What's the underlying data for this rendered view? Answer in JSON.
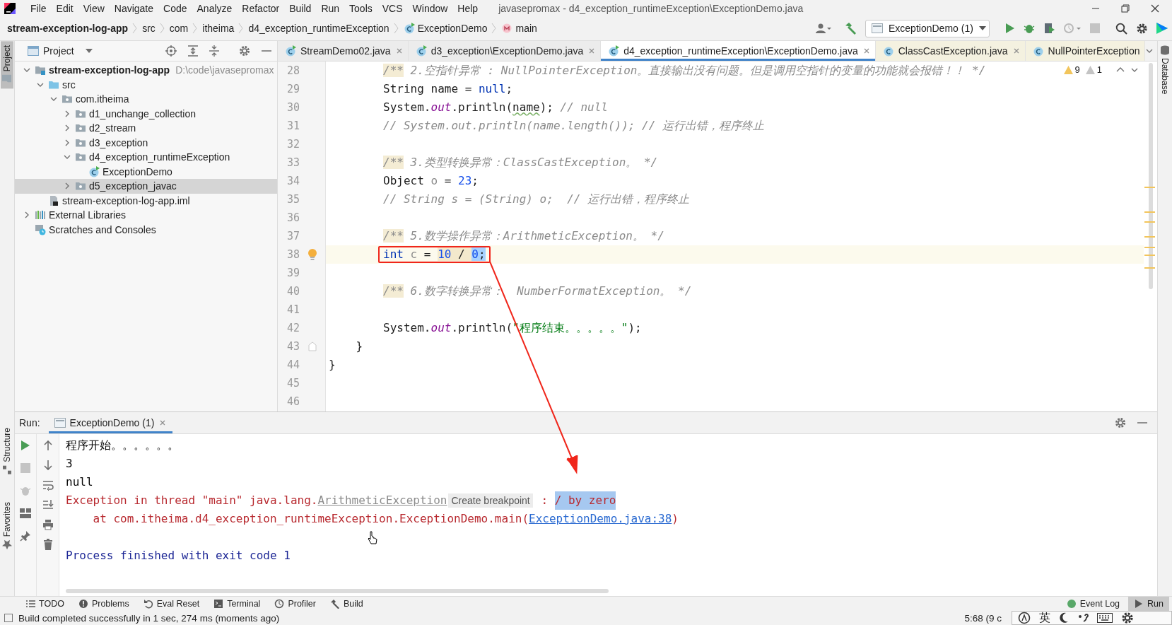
{
  "window": {
    "title": "javasepromax - d4_exception_runtimeException\\ExceptionDemo.java"
  },
  "menu": [
    "File",
    "Edit",
    "View",
    "Navigate",
    "Code",
    "Analyze",
    "Refactor",
    "Build",
    "Run",
    "Tools",
    "VCS",
    "Window",
    "Help"
  ],
  "breadcrumbs": [
    {
      "label": "stream-exception-log-app",
      "kind": "module"
    },
    {
      "label": "src",
      "kind": "plain"
    },
    {
      "label": "com",
      "kind": "plain"
    },
    {
      "label": "itheima",
      "kind": "plain"
    },
    {
      "label": "d4_exception_runtimeException",
      "kind": "plain"
    },
    {
      "label": "ExceptionDemo",
      "kind": "class"
    },
    {
      "label": "main",
      "kind": "method"
    }
  ],
  "run_config": {
    "label": "ExceptionDemo (1)"
  },
  "side_tabs": {
    "left": [
      {
        "label": "Project",
        "selected": true
      },
      {
        "label": "Structure",
        "selected": false
      },
      {
        "label": "Favorites",
        "selected": false
      }
    ],
    "right": [
      {
        "label": "Database",
        "selected": false
      }
    ]
  },
  "project": {
    "title": "Project",
    "tree": [
      {
        "label": "stream-exception-log-app",
        "kind": "module",
        "hint": "D:\\code\\javasepromax",
        "expanded": true,
        "selected": false,
        "children": [
          {
            "label": "src",
            "kind": "source",
            "expanded": true,
            "selected": false,
            "children": [
              {
                "label": "com.itheima",
                "kind": "package",
                "expanded": true,
                "selected": false,
                "children": [
                  {
                    "label": "d1_unchange_collection",
                    "kind": "package",
                    "expanded": false,
                    "selected": false
                  },
                  {
                    "label": "d2_stream",
                    "kind": "package",
                    "expanded": false,
                    "selected": false
                  },
                  {
                    "label": "d3_exception",
                    "kind": "package",
                    "expanded": false,
                    "selected": false
                  },
                  {
                    "label": "d4_exception_runtimeException",
                    "kind": "package",
                    "expanded": true,
                    "selected": false,
                    "children": [
                      {
                        "label": "ExceptionDemo",
                        "kind": "class",
                        "selected": false
                      }
                    ]
                  },
                  {
                    "label": "d5_exception_javac",
                    "kind": "package",
                    "expanded": false,
                    "selected": true
                  }
                ]
              }
            ]
          },
          {
            "label": "stream-exception-log-app.iml",
            "kind": "file",
            "selected": false
          }
        ]
      },
      {
        "label": "External Libraries",
        "kind": "libraries",
        "expanded": false,
        "selected": false
      },
      {
        "label": "Scratches and Consoles",
        "kind": "scratches",
        "selected": false
      }
    ]
  },
  "editor_tabs": [
    {
      "label": "StreamDemo02.java",
      "kind": "project",
      "selected": false,
      "closable": true
    },
    {
      "label": "d3_exception\\ExceptionDemo.java",
      "kind": "project",
      "selected": false,
      "closable": true
    },
    {
      "label": "d4_exception_runtimeException\\ExceptionDemo.java",
      "kind": "project",
      "selected": true,
      "closable": true
    },
    {
      "label": "ClassCastException.java",
      "kind": "library",
      "selected": false,
      "closable": true
    },
    {
      "label": "NullPointerException",
      "kind": "library",
      "selected": false,
      "closable": false
    }
  ],
  "editor": {
    "warnings": "9",
    "weak_warnings": "1",
    "lines": [
      {
        "number": "28",
        "current": false,
        "tokens": [
          {
            "kind": "doc_marker",
            "text": "        /**"
          },
          {
            "kind": "comment",
            "text": " 2.空指针异常 : NullPointerException。直接输出没有问题。但是调用空指针的变量的功能就会报错！！ */"
          }
        ]
      },
      {
        "number": "29",
        "current": false,
        "tokens": [
          {
            "kind": "plain",
            "text": "        String name = "
          },
          {
            "kind": "keyword",
            "text": "null"
          },
          {
            "kind": "plain",
            "text": ";"
          }
        ]
      },
      {
        "number": "30",
        "current": false,
        "tokens": [
          {
            "kind": "plain",
            "text": "        System."
          },
          {
            "kind": "field",
            "text": "out"
          },
          {
            "kind": "plain",
            "text": ".println("
          },
          {
            "kind": "plain",
            "text": "name",
            "typo": true
          },
          {
            "kind": "plain",
            "text": "); "
          },
          {
            "kind": "comment",
            "text": "// null"
          }
        ]
      },
      {
        "number": "31",
        "current": false,
        "tokens": [
          {
            "kind": "comment",
            "text": "        // System.out.println(name.length()); // 运行出错，程序终止"
          }
        ]
      },
      {
        "number": "32",
        "current": false
      },
      {
        "number": "33",
        "current": false,
        "tokens": [
          {
            "kind": "doc_marker",
            "text": "        /**"
          },
          {
            "kind": "comment",
            "text": " 3.类型转换异常：ClassCastException。 */"
          }
        ]
      },
      {
        "number": "34",
        "current": false,
        "tokens": [
          {
            "kind": "plain",
            "text": "        Object "
          },
          {
            "kind": "unused",
            "text": "o"
          },
          {
            "kind": "plain",
            "text": " = "
          },
          {
            "kind": "number",
            "text": "23"
          },
          {
            "kind": "plain",
            "text": ";"
          }
        ]
      },
      {
        "number": "35",
        "current": false,
        "tokens": [
          {
            "kind": "comment",
            "text": "        // String s = (String) o;  // 运行出错，程序终止"
          }
        ]
      },
      {
        "number": "36",
        "current": false
      },
      {
        "number": "37",
        "current": false,
        "tokens": [
          {
            "kind": "doc_marker",
            "text": "        /**"
          },
          {
            "kind": "comment",
            "text": " 5.数学操作异常：ArithmeticException。 */"
          }
        ]
      },
      {
        "number": "38",
        "current": true,
        "annotated": true,
        "bulb": true,
        "tokens": [
          {
            "kind": "keyword",
            "text": "        int"
          },
          {
            "kind": "unused",
            "text": " c"
          },
          {
            "kind": "plain",
            "text": " = "
          },
          {
            "kind": "number",
            "text": "10",
            "usage": true
          },
          {
            "kind": "plain",
            "text": " / ",
            "usage": true
          },
          {
            "kind": "number",
            "text": "0",
            "selected": true
          },
          {
            "kind": "plain",
            "text": ";",
            "selected": true
          }
        ]
      },
      {
        "number": "39",
        "current": false
      },
      {
        "number": "40",
        "current": false,
        "tokens": [
          {
            "kind": "doc_marker",
            "text": "        /**"
          },
          {
            "kind": "comment",
            "text": " 6.数字转换异常：  NumberFormatException。 */"
          }
        ]
      },
      {
        "number": "41",
        "current": false
      },
      {
        "number": "42",
        "current": false,
        "tokens": [
          {
            "kind": "plain",
            "text": "        System."
          },
          {
            "kind": "field",
            "text": "out"
          },
          {
            "kind": "plain",
            "text": ".println("
          },
          {
            "kind": "string",
            "text": "\"程序结束。。。。。\""
          },
          {
            "kind": "plain",
            "text": ");"
          }
        ]
      },
      {
        "number": "43",
        "current": false,
        "fold_marker": true,
        "tokens": [
          {
            "kind": "plain",
            "text": "    }"
          }
        ]
      },
      {
        "number": "44",
        "current": false,
        "tokens": [
          {
            "kind": "plain",
            "text": "}"
          }
        ]
      },
      {
        "number": "45",
        "current": false
      },
      {
        "number": "46",
        "current": false
      }
    ]
  },
  "run_panel": {
    "label": "Run:",
    "tab": {
      "label": "ExceptionDemo (1)",
      "selected": true
    },
    "output": [
      {
        "kind": "text",
        "segments": [
          {
            "kind": "output",
            "text": "程序开始。。。。。。"
          }
        ]
      },
      {
        "kind": "text",
        "segments": [
          {
            "kind": "output",
            "text": "3"
          }
        ]
      },
      {
        "kind": "text",
        "segments": [
          {
            "kind": "output",
            "text": "null"
          }
        ]
      },
      {
        "kind": "text",
        "segments": [
          {
            "kind": "error",
            "text": "Exception in thread \"main\" java.lang."
          },
          {
            "kind": "error_link",
            "text": "ArithmeticException"
          },
          {
            "kind": "hint",
            "text": "Create breakpoint"
          },
          {
            "kind": "error",
            "text": " : "
          },
          {
            "kind": "error_selected",
            "text": "/ by zero"
          }
        ]
      },
      {
        "kind": "text",
        "segments": [
          {
            "kind": "error",
            "text": "    at com.itheima.d4_exception_runtimeException.ExceptionDemo.main("
          },
          {
            "kind": "link",
            "text": "ExceptionDemo.java:38"
          },
          {
            "kind": "error",
            "text": ")"
          }
        ]
      },
      {
        "kind": "blank"
      },
      {
        "kind": "text",
        "segments": [
          {
            "kind": "info",
            "text": "Process finished with exit code 1"
          }
        ]
      }
    ]
  },
  "tool_windows": [
    {
      "label": "TODO",
      "kind": "todo",
      "selected": false
    },
    {
      "label": "Problems",
      "kind": "problems",
      "selected": false
    },
    {
      "label": "Eval Reset",
      "kind": "reset",
      "selected": false
    },
    {
      "label": "Terminal",
      "kind": "terminal",
      "selected": false
    },
    {
      "label": "Profiler",
      "kind": "profiler",
      "selected": false
    },
    {
      "label": "Build",
      "kind": "build",
      "selected": false
    }
  ],
  "tool_windows_right": [
    {
      "label": "Event Log",
      "kind": "event",
      "selected": false
    },
    {
      "label": "Run",
      "kind": "run",
      "selected": true
    }
  ],
  "status_bar": {
    "message": "Build completed successfully in 1 sec, 274 ms (moments ago)",
    "position": "5:68 (9 c",
    "ime_mode": "英"
  }
}
